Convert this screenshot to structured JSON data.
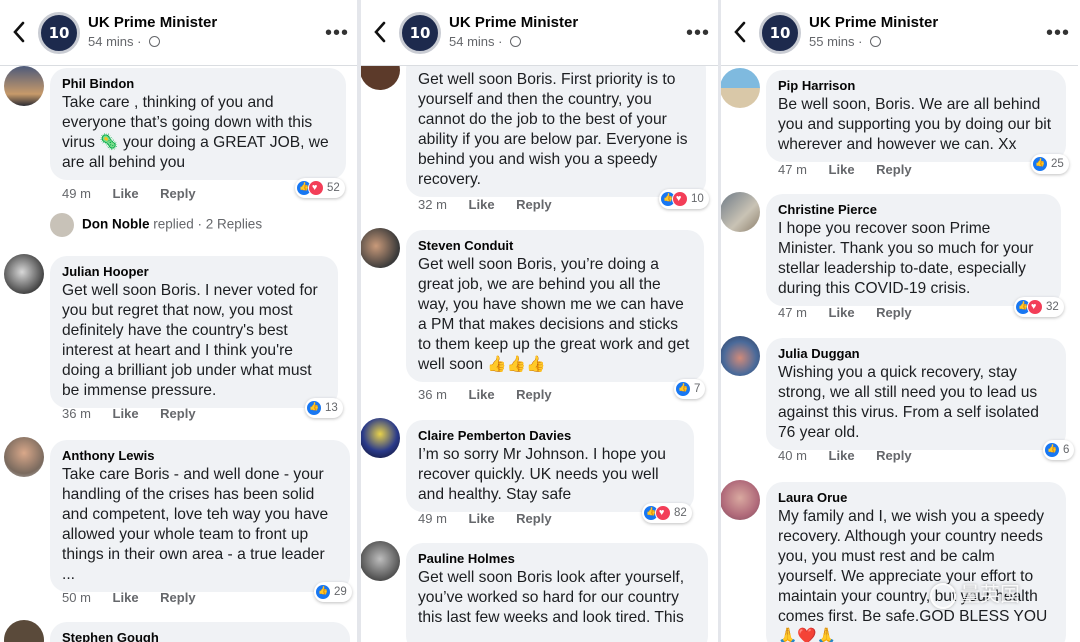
{
  "panels": [
    {
      "page_name": "UK Prime Minister",
      "post_time": "54 mins",
      "comments": [
        {
          "author": "Phil Bindon",
          "text": "Take care , thinking of you and everyone that’s going down with this virus 🦠 your doing a GREAT JOB, we are all behind you",
          "time": "49 m",
          "reactions": "52"
        },
        {
          "replied_author": "Don Noble",
          "replied_text": "replied · 2 Replies"
        },
        {
          "author": "Julian Hooper",
          "text": "Get well soon Boris. I never voted for you but regret that now, you most definitely have the country's best interest at heart and I think you're doing a brilliant job under what must be immense pressure.",
          "time": "36 m",
          "reactions": "13"
        },
        {
          "author": "Anthony Lewis",
          "text": "Take care Boris - and well done - your handling of the crises has been solid and competent, love teh way you have allowed your whole team to front up things in their own area - a true leader ...",
          "time": "50 m",
          "reactions": "29"
        },
        {
          "author": "Stephen Gough"
        }
      ]
    },
    {
      "page_name": "UK Prime Minister",
      "post_time": "54 mins",
      "comments": [
        {
          "text": "Get well soon Boris. First priority is to yourself and then the country, you cannot do the job to the best of your ability if you are below par. Everyone is behind you and wish you a speedy recovery.",
          "time": "32 m",
          "reactions": "10"
        },
        {
          "author": "Steven Conduit",
          "text": "Get well soon Boris, you’re doing a great job, we are behind you all the way, you have shown me we can have a PM that makes decisions and sticks to them keep up the great work and get well soon 👍👍👍",
          "time": "36 m",
          "reactions": "7"
        },
        {
          "author": "Claire Pemberton Davies",
          "text": "I’m so sorry Mr Johnson.  I hope you recover quickly.  UK needs you well and healthy.  Stay safe",
          "time": "49 m",
          "reactions": "82"
        },
        {
          "author": "Pauline Holmes",
          "text": "Get well soon Boris look after yourself, you’ve worked so hard for our country this last few weeks and look tired. This"
        }
      ]
    },
    {
      "page_name": "UK Prime Minister",
      "post_time": "55 mins",
      "comments": [
        {
          "author": "Pip Harrison",
          "text": "Be well soon, Boris. We are all behind you and supporting you by doing our bit wherever and however we can. Xx",
          "time": "47 m",
          "reactions": "25"
        },
        {
          "author": "Christine Pierce",
          "text": "I hope you recover soon Prime Minister. Thank you so much for your stellar leadership to-date, especially during this COVID-19 crisis.",
          "time": "47 m",
          "reactions": "32"
        },
        {
          "author": "Julia Duggan",
          "text": "Wishing you a quick recovery, stay strong, we all still need you to lead us against this virus. From a self isolated 76 year old.",
          "time": "40 m",
          "reactions": "6"
        },
        {
          "author": "Laura Orue",
          "text": "My family and I, we wish you a speedy recovery. Although your country needs you, you must rest and be calm yourself. We appreciate your effort to maintain your country, but your health comes first. Be safe.GOD BLESS YOU 🙏❤️🙏"
        }
      ]
    }
  ],
  "labels": {
    "like": "Like",
    "reply": "Reply"
  },
  "watermark": "量英国",
  "colors": {
    "bubble": "#f0f2f5",
    "like_blue": "#1877f2",
    "love_red": "#f33e58",
    "meta_gray": "#65676b"
  }
}
